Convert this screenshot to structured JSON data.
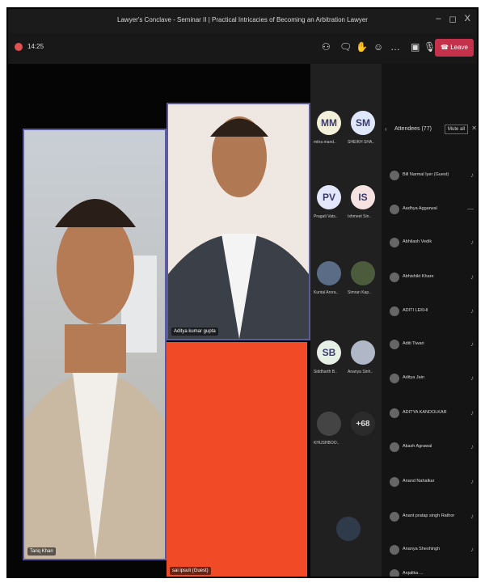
{
  "window": {
    "title": "Lawyer's Conclave - Seminar II | Practical Intricacies of Becoming an Arbitration Lawyer",
    "controls": [
      "–",
      "◻",
      "X"
    ]
  },
  "toolbar": {
    "time": "14:25",
    "leave_label": "Leave",
    "icons": [
      "people-icon",
      "chat-icon",
      "raise-hand-icon",
      "reactions-icon",
      "more-icon",
      "camera-icon",
      "mic-icon",
      "share-icon"
    ]
  },
  "stage": {
    "tiles": [
      {
        "name": "Tariq Khan"
      },
      {
        "name": "Aditya kumar gupta"
      },
      {
        "name": "sai ipsuli (Guest)"
      }
    ]
  },
  "people": {
    "avatars": [
      {
        "initials": "MM",
        "label": "mitra mand..",
        "color": "#f2f0d8"
      },
      {
        "initials": "SM",
        "label": "SHEIKH SHA..",
        "color": "#dfe7fb"
      },
      {
        "initials": "PV",
        "label": "Pragati Vats..",
        "color": "#e4e6fb"
      },
      {
        "initials": "IS",
        "label": "Ishmeet Sin..",
        "color": "#f7e2e2"
      },
      {
        "initials": "",
        "label": "Kuntal Arora..",
        "color": "#5a6c86"
      },
      {
        "initials": "",
        "label": "Simran Kap..",
        "color": "#4b5b3c"
      },
      {
        "initials": "SB",
        "label": "Siddharth B..",
        "color": "#e6efe6"
      },
      {
        "initials": "",
        "label": "Ananya Sinh..",
        "color": "#b0b7c6"
      },
      {
        "initials": "",
        "label": "KHUSHBOO..",
        "color": "#444"
      },
      {
        "initials": "+68",
        "label": "",
        "color": "#2b2b2b"
      }
    ]
  },
  "attendees": {
    "title": "Attendees (77)",
    "mute_label": "Mute all",
    "list": [
      "Bill Narmal Iyer (Guest)",
      "Aadhya Aggarwal",
      "Abhilash Vedik",
      "Abhishikt Khare",
      "ADITI LEKHI",
      "Aditi Tiwari",
      "Aditya Jain",
      "ADITYA KANDOLKAR",
      "Akash Agrawal",
      "Anand Nahalkar",
      "Anant pratap singh Rathor",
      "Ananya Sheshingh",
      "Anjalika ..."
    ]
  }
}
